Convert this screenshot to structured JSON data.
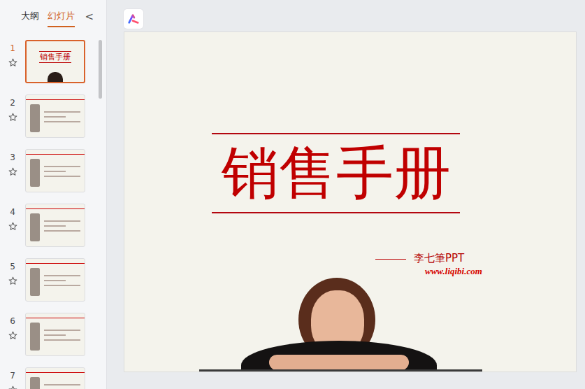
{
  "sidebar": {
    "tabs": [
      {
        "label": "大纲",
        "selected": false
      },
      {
        "label": "幻灯片",
        "selected": true
      }
    ],
    "collapse": "<",
    "slides": [
      {
        "number": "1",
        "selected": true,
        "starred": false,
        "title": "销售手册"
      },
      {
        "number": "2",
        "selected": false,
        "starred": false
      },
      {
        "number": "3",
        "selected": false,
        "starred": false
      },
      {
        "number": "4",
        "selected": false,
        "starred": false
      },
      {
        "number": "5",
        "selected": false,
        "starred": false
      },
      {
        "number": "6",
        "selected": false,
        "starred": false
      },
      {
        "number": "7",
        "selected": false,
        "starred": false
      }
    ]
  },
  "slide": {
    "title": "销售手册",
    "author": "李七筆PPT",
    "website": "www.liqibi.com"
  }
}
